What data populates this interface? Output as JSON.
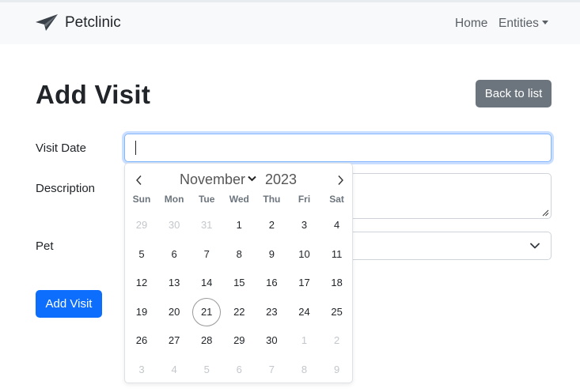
{
  "navbar": {
    "brand": "Petclinic",
    "brand_icon": "paper-plane-icon",
    "home": "Home",
    "entities": "Entities"
  },
  "page": {
    "title": "Add Visit",
    "back_label": "Back to list"
  },
  "form": {
    "visit_date_label": "Visit Date",
    "visit_date_value": "",
    "description_label": "Description",
    "description_value": "",
    "pet_label": "Pet",
    "pet_value": "",
    "submit_label": "Add Visit"
  },
  "datepicker": {
    "month": "November",
    "year": "2023",
    "weekdays": [
      "Sun",
      "Mon",
      "Tue",
      "Wed",
      "Thu",
      "Fri",
      "Sat"
    ],
    "weeks": [
      [
        {
          "d": "29",
          "muted": true
        },
        {
          "d": "30",
          "muted": true
        },
        {
          "d": "31",
          "muted": true
        },
        {
          "d": "1"
        },
        {
          "d": "2"
        },
        {
          "d": "3"
        },
        {
          "d": "4"
        }
      ],
      [
        {
          "d": "5"
        },
        {
          "d": "6"
        },
        {
          "d": "7"
        },
        {
          "d": "8"
        },
        {
          "d": "9"
        },
        {
          "d": "10"
        },
        {
          "d": "11"
        }
      ],
      [
        {
          "d": "12"
        },
        {
          "d": "13"
        },
        {
          "d": "14"
        },
        {
          "d": "15"
        },
        {
          "d": "16"
        },
        {
          "d": "17"
        },
        {
          "d": "18"
        }
      ],
      [
        {
          "d": "19"
        },
        {
          "d": "20"
        },
        {
          "d": "21",
          "today": true
        },
        {
          "d": "22"
        },
        {
          "d": "23"
        },
        {
          "d": "24"
        },
        {
          "d": "25"
        }
      ],
      [
        {
          "d": "26"
        },
        {
          "d": "27"
        },
        {
          "d": "28"
        },
        {
          "d": "29"
        },
        {
          "d": "30"
        },
        {
          "d": "1",
          "muted": true
        },
        {
          "d": "2",
          "muted": true
        }
      ],
      [
        {
          "d": "3",
          "muted": true
        },
        {
          "d": "4",
          "muted": true
        },
        {
          "d": "5",
          "muted": true
        },
        {
          "d": "6",
          "muted": true
        },
        {
          "d": "7",
          "muted": true
        },
        {
          "d": "8",
          "muted": true
        },
        {
          "d": "9",
          "muted": true
        }
      ]
    ]
  },
  "colors": {
    "primary": "#0d6efd",
    "secondary": "#6c757d",
    "navbar_bg": "#f8f9fa",
    "focus_border": "#86b7fe"
  }
}
